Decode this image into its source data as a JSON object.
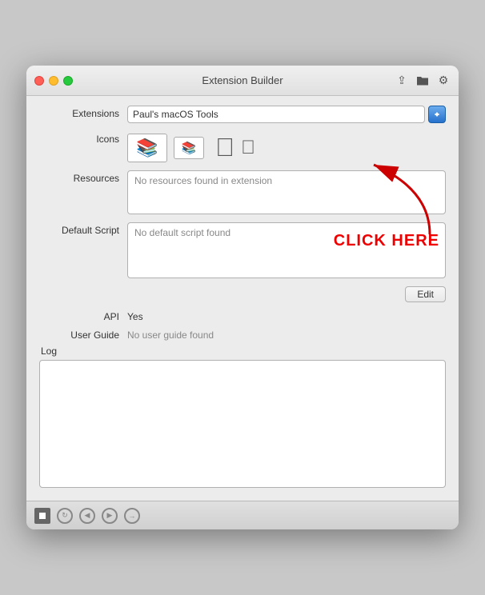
{
  "window": {
    "title": "Extension Builder"
  },
  "toolbar_icons": [
    "import-icon",
    "folder-icon",
    "gear-icon"
  ],
  "form": {
    "extensions_label": "Extensions",
    "extensions_value": "Paul's macOS Tools",
    "icons_label": "Icons",
    "resources_label": "Resources",
    "resources_value": "No resources found in extension",
    "default_script_label": "Default Script",
    "default_script_value": "No default script found",
    "api_label": "API",
    "api_value": "Yes",
    "user_guide_label": "User Guide",
    "user_guide_value": "No user guide found"
  },
  "buttons": {
    "edit_label": "Edit"
  },
  "log": {
    "label": "Log"
  },
  "annotation": {
    "click_here": "CLICK HERE"
  },
  "bottom_bar": {
    "icons": [
      "stop-icon",
      "refresh-icon",
      "back-icon",
      "forward-icon",
      "share-icon"
    ]
  }
}
